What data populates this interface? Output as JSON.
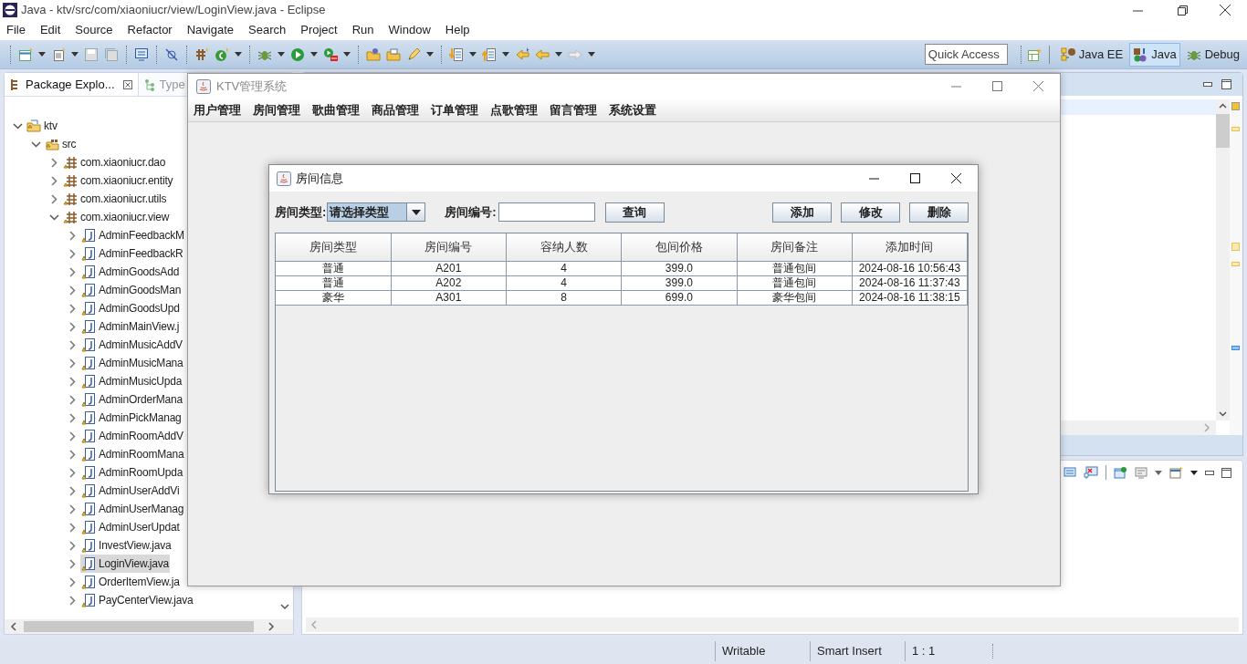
{
  "window": {
    "title": "Java - ktv/src/com/xiaoniucr/view/LoginView.java - Eclipse"
  },
  "menu": [
    "File",
    "Edit",
    "Source",
    "Refactor",
    "Navigate",
    "Search",
    "Project",
    "Run",
    "Window",
    "Help"
  ],
  "quick_access": {
    "placeholder": "Quick Access"
  },
  "perspectives": [
    {
      "label": "Java EE",
      "selected": false
    },
    {
      "label": "Java",
      "selected": true
    },
    {
      "label": "Debug",
      "selected": false
    }
  ],
  "view_tabs": [
    {
      "label": "Package Explo...",
      "selected": true
    },
    {
      "label": "Type",
      "selected": false
    }
  ],
  "tree": [
    {
      "label": "ktv",
      "kind": "project",
      "expanded": true,
      "selected": false,
      "children": [
        {
          "label": "src",
          "kind": "folder",
          "expanded": true,
          "selected": false,
          "children": [
            {
              "label": "com.xiaoniucr.dao",
              "kind": "package",
              "expanded": false,
              "selected": false
            },
            {
              "label": "com.xiaoniucr.entity",
              "kind": "package",
              "expanded": false,
              "selected": false
            },
            {
              "label": "com.xiaoniucr.utils",
              "kind": "package",
              "expanded": false,
              "selected": false
            },
            {
              "label": "com.xiaoniucr.view",
              "kind": "package",
              "expanded": true,
              "selected": false,
              "children": [
                {
                  "label": "AdminFeedbackM",
                  "kind": "file",
                  "expanded": false,
                  "selected": false
                },
                {
                  "label": "AdminFeedbackR",
                  "kind": "file",
                  "expanded": false,
                  "selected": false
                },
                {
                  "label": "AdminGoodsAdd",
                  "kind": "file",
                  "expanded": false,
                  "selected": false
                },
                {
                  "label": "AdminGoodsMan",
                  "kind": "file",
                  "expanded": false,
                  "selected": false
                },
                {
                  "label": "AdminGoodsUpd",
                  "kind": "file",
                  "expanded": false,
                  "selected": false
                },
                {
                  "label": "AdminMainView.j",
                  "kind": "file",
                  "expanded": false,
                  "selected": false
                },
                {
                  "label": "AdminMusicAddV",
                  "kind": "file",
                  "expanded": false,
                  "selected": false
                },
                {
                  "label": "AdminMusicMana",
                  "kind": "file",
                  "expanded": false,
                  "selected": false
                },
                {
                  "label": "AdminMusicUpda",
                  "kind": "file",
                  "expanded": false,
                  "selected": false
                },
                {
                  "label": "AdminOrderMana",
                  "kind": "file",
                  "expanded": false,
                  "selected": false
                },
                {
                  "label": "AdminPickManag",
                  "kind": "file",
                  "expanded": false,
                  "selected": false
                },
                {
                  "label": "AdminRoomAddV",
                  "kind": "file",
                  "expanded": false,
                  "selected": false
                },
                {
                  "label": "AdminRoomMana",
                  "kind": "file",
                  "expanded": false,
                  "selected": false
                },
                {
                  "label": "AdminRoomUpda",
                  "kind": "file",
                  "expanded": false,
                  "selected": false
                },
                {
                  "label": "AdminUserAddVi",
                  "kind": "file",
                  "expanded": false,
                  "selected": false
                },
                {
                  "label": "AdminUserManag",
                  "kind": "file",
                  "expanded": false,
                  "selected": false
                },
                {
                  "label": "AdminUserUpdat",
                  "kind": "file",
                  "expanded": false,
                  "selected": false
                },
                {
                  "label": "InvestView.java",
                  "kind": "file",
                  "expanded": false,
                  "selected": false
                },
                {
                  "label": "LoginView.java",
                  "kind": "file",
                  "expanded": false,
                  "selected": true
                },
                {
                  "label": "OrderItemView.ja",
                  "kind": "file",
                  "expanded": false,
                  "selected": false
                },
                {
                  "label": "PayCenterView.java",
                  "kind": "file",
                  "expanded": false,
                  "selected": false
                }
              ]
            }
          ]
        }
      ]
    }
  ],
  "status_bar": [
    "Writable",
    "Smart Insert",
    "1 : 1"
  ],
  "app_window": {
    "title": "KTV管理系统",
    "menu": [
      "用户管理",
      "房间管理",
      "歌曲管理",
      "商品管理",
      "订单管理",
      "点歌管理",
      "留言管理",
      "系统设置"
    ]
  },
  "dialog": {
    "title": "房间信息",
    "type_label": "房间类型:",
    "type_value": "请选择类型",
    "number_label": "房间编号:",
    "search_button": "查询",
    "actions": [
      "添加",
      "修改",
      "删除"
    ],
    "table": {
      "columns": [
        "房间类型",
        "房间编号",
        "容纳人数",
        "包间价格",
        "房间备注",
        "添加时间"
      ],
      "rows": [
        [
          "普通",
          "A201",
          "4",
          "399.0",
          "普通包间",
          "2024-08-16 10:56:43"
        ],
        [
          "普通",
          "A202",
          "4",
          "399.0",
          "普通包间",
          "2024-08-16 11:37:43"
        ],
        [
          "豪华",
          "A301",
          "8",
          "699.0",
          "豪华包间",
          "2024-08-16 11:38:15"
        ]
      ]
    }
  }
}
